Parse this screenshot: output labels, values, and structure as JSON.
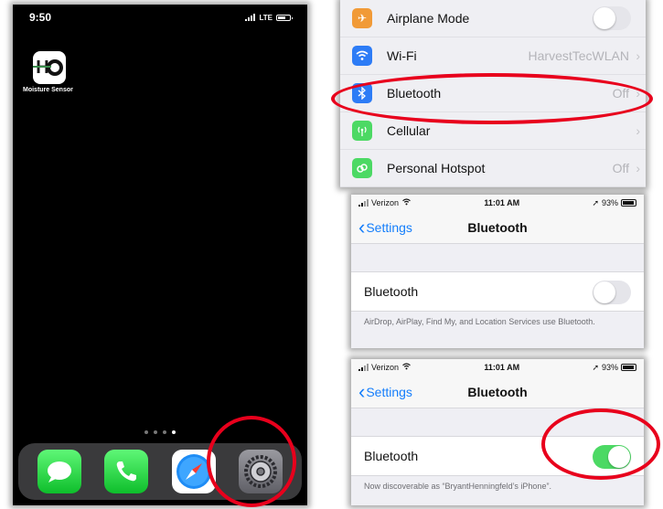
{
  "home": {
    "time": "9:50",
    "network": "LTE",
    "app_label": "Moisture Sensor",
    "dock_icons": [
      "messages-icon",
      "phone-icon",
      "safari-icon",
      "settings-icon"
    ]
  },
  "settings_list": {
    "rows": [
      {
        "label": "Airplane Mode",
        "value": "",
        "color": "#f19a37",
        "icon": "airplane-icon"
      },
      {
        "label": "Wi-Fi",
        "value": "HarvestTecWLAN",
        "color": "#2d7cf6",
        "icon": "wifi-icon"
      },
      {
        "label": "Bluetooth",
        "value": "Off",
        "color": "#2d7cf6",
        "icon": "bluetooth-icon"
      },
      {
        "label": "Cellular",
        "value": "",
        "color": "#4cd964",
        "icon": "cellular-icon"
      },
      {
        "label": "Personal Hotspot",
        "value": "Off",
        "color": "#4cd964",
        "icon": "hotspot-icon"
      }
    ]
  },
  "bt_off": {
    "carrier": "Verizon",
    "time": "11:01 AM",
    "battery": "93%",
    "back": "Settings",
    "title": "Bluetooth",
    "row_label": "Bluetooth",
    "toggle_on": false,
    "footnote": "AirDrop, AirPlay, Find My, and Location Services use Bluetooth."
  },
  "bt_on": {
    "carrier": "Verizon",
    "time": "11:01 AM",
    "battery": "93%",
    "back": "Settings",
    "title": "Bluetooth",
    "row_label": "Bluetooth",
    "toggle_on": true,
    "footnote": "Now discoverable as “BryantHenningfeld’s iPhone”."
  },
  "colors": {
    "highlight_ring": "#e8001c",
    "ios_blue": "#157efb",
    "toggle_on": "#4cd964"
  }
}
